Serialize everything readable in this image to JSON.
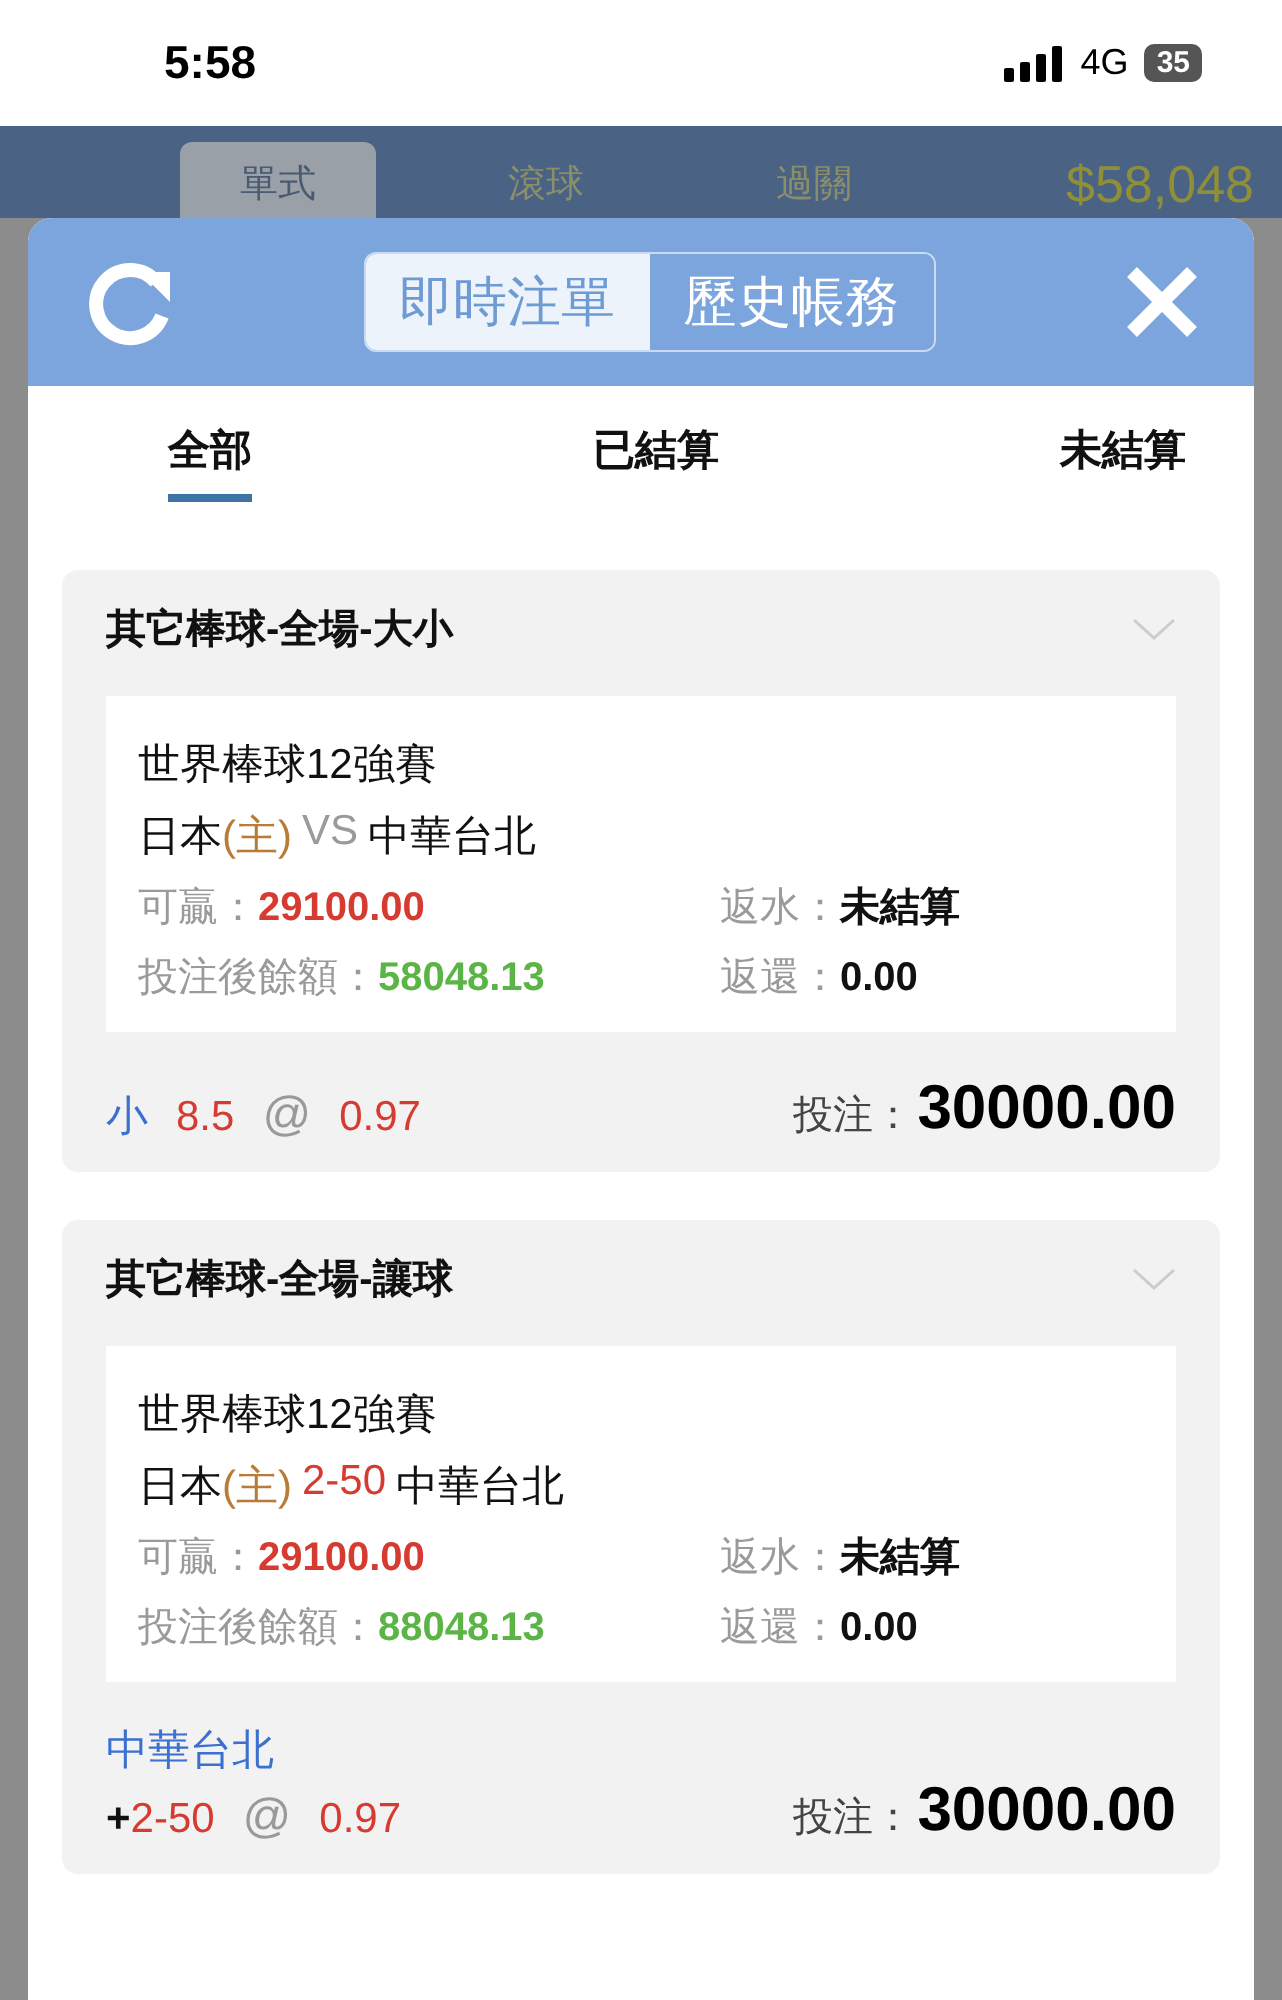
{
  "status_bar": {
    "time": "5:58",
    "network": "4G",
    "battery": "35"
  },
  "background_header": {
    "tabs": [
      {
        "label": "單式",
        "selected": true
      },
      {
        "label": "滾球",
        "selected": false
      },
      {
        "label": "過關",
        "selected": false
      }
    ],
    "balance": "$58,048"
  },
  "modal": {
    "segments": [
      {
        "label": "即時注單",
        "selected": true
      },
      {
        "label": "歷史帳務",
        "selected": false
      }
    ],
    "filter_tabs": [
      {
        "label": "全部",
        "selected": true
      },
      {
        "label": "已結算",
        "selected": false
      },
      {
        "label": "未結算",
        "selected": false
      }
    ],
    "bets": [
      {
        "title": "其它棒球-全場-大小",
        "league": "世界棒球12強賽",
        "home": "日本",
        "home_tag": "(主)",
        "middle": "VS",
        "kind": "total",
        "away": "中華台北",
        "win_label": "可贏：",
        "win": "29100.00",
        "rebate_label": "返水：",
        "rebate": "未結算",
        "balance_label": "投注後餘額：",
        "balance": "58048.13",
        "return_label": "返還：",
        "return": "0.00",
        "pick": "小",
        "line": "8.5",
        "at": "@",
        "odds": "0.97",
        "stake_label": "投注：",
        "stake": "30000.00"
      },
      {
        "title": "其它棒球-全場-讓球",
        "league": "世界棒球12強賽",
        "home": "日本",
        "home_tag": "(主)",
        "middle": "2-50",
        "kind": "handicap",
        "away": "中華台北",
        "win_label": "可贏：",
        "win": "29100.00",
        "rebate_label": "返水：",
        "rebate": "未結算",
        "balance_label": "投注後餘額：",
        "balance": "88048.13",
        "return_label": "返還：",
        "return": "0.00",
        "pick": "中華台北",
        "sign": "+",
        "line": "2-50",
        "at": "@",
        "odds": "0.97",
        "stake_label": "投注：",
        "stake": "30000.00"
      }
    ]
  }
}
